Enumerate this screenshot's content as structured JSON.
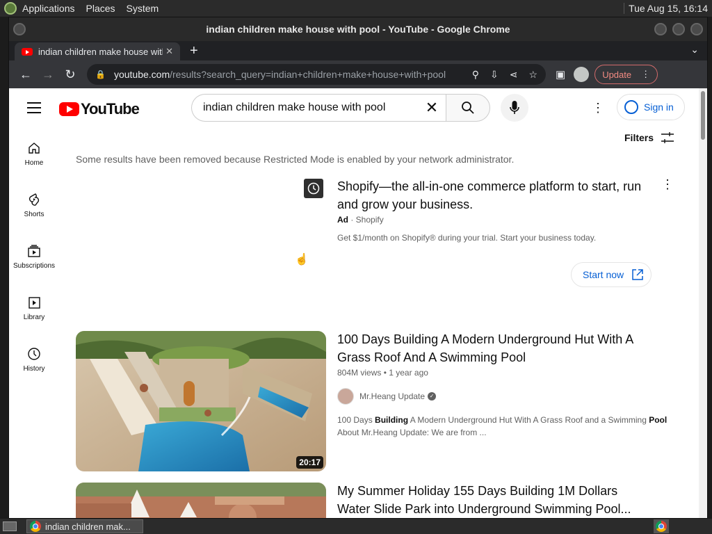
{
  "os": {
    "menus": [
      "Applications",
      "Places",
      "System"
    ],
    "clock": "Tue Aug 15, 16:14"
  },
  "window": {
    "title": "indian children make house with pool - YouTube - Google Chrome"
  },
  "browser": {
    "tab_title": "indian children make house with pool - YouTube",
    "url_host": "youtube.com",
    "url_path": "/results?search_query=indian+children+make+house+with+pool",
    "update_label": "Update"
  },
  "youtube": {
    "search_query": "indian children make house with pool",
    "sign_in_label": "Sign in",
    "filters_label": "Filters",
    "restricted_notice": "Some results have been removed because Restricted Mode is enabled by your network administrator.",
    "guide": [
      {
        "label": "Home",
        "icon": "home-icon"
      },
      {
        "label": "Shorts",
        "icon": "shorts-icon"
      },
      {
        "label": "Subscriptions",
        "icon": "subscriptions-icon"
      },
      {
        "label": "Library",
        "icon": "library-icon"
      },
      {
        "label": "History",
        "icon": "history-icon"
      }
    ],
    "ad": {
      "title": "Shopify—the all-in-one commerce platform to start, run and grow your business.",
      "badge": "Ad",
      "advertiser": "Shopify",
      "description": "Get $1/month on Shopify® during your trial. Start your business today.",
      "cta": "Start now"
    },
    "results": [
      {
        "title": "100 Days Building A Modern Underground Hut With A Grass Roof And A Swimming Pool",
        "views": "804M views",
        "age": "1 year ago",
        "channel": "Mr.Heang Update",
        "duration": "20:17",
        "desc_1": "100 Days ",
        "desc_b1": "Building",
        "desc_2": " A Modern Underground Hut With A Grass Roof and a Swimming ",
        "desc_b2": "Pool",
        "desc_line2": "About Mr.Heang Update: We are from ..."
      },
      {
        "title": "My Summer Holiday 155 Days Building 1M Dollars Water Slide Park into Underground Swimming Pool..."
      }
    ]
  },
  "taskbar": {
    "task_label": "indian children mak..."
  },
  "colors": {
    "yt_red": "#ff0000",
    "link_blue": "#065fd4",
    "chrome_dark": "#35363a"
  }
}
